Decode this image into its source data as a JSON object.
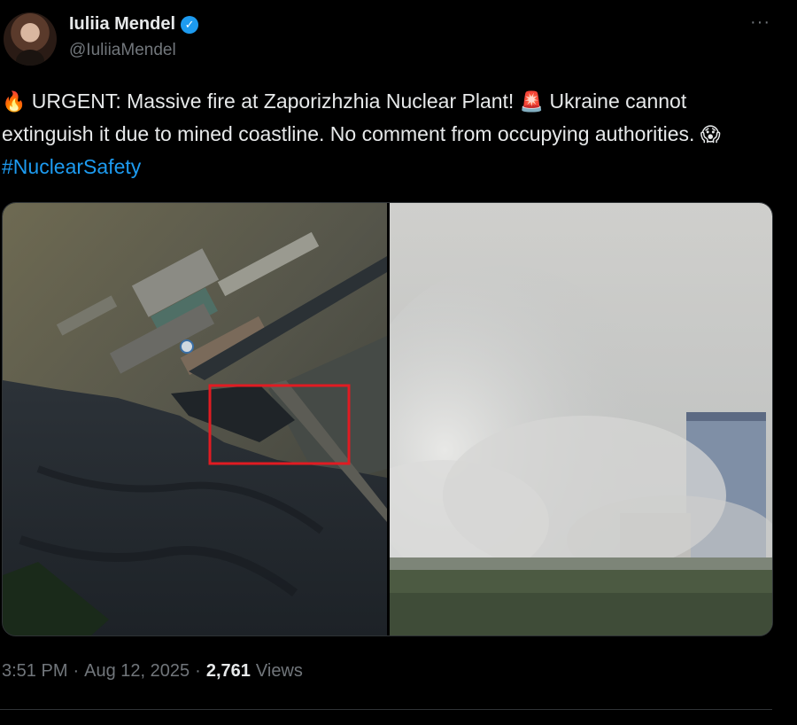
{
  "author": {
    "display_name": "Iuliia Mendel",
    "handle": "@IuliiaMendel",
    "verified_icon": "verified-badge-icon",
    "avatar": "avatar-photo"
  },
  "more_icon": "more-options-icon",
  "more_glyph": "···",
  "tweet": {
    "emoji_fire": "🔥",
    "text_part1": " URGENT: Massive fire at Zaporizhzhia Nuclear Plant! ",
    "emoji_siren": "🚨",
    "text_part2": " Ukraine cannot extinguish it due to mined coastline. No comment from occupying authorities. ",
    "emoji_scream": "😱",
    "hashtag": "#NuclearSafety"
  },
  "media": {
    "left_image": "satellite-view-of-nuclear-plant",
    "right_image": "smoke-fire-near-plant"
  },
  "footer": {
    "time": "3:51 PM",
    "separator1": "·",
    "date": "Aug 12, 2025",
    "separator2": "·",
    "views_count": "2,761",
    "views_label": "Views"
  },
  "colors": {
    "background": "#000000",
    "text": "#e7e9ea",
    "muted": "#71767b",
    "accent": "#1d9bf0",
    "highlight_box": "#e11b22"
  }
}
